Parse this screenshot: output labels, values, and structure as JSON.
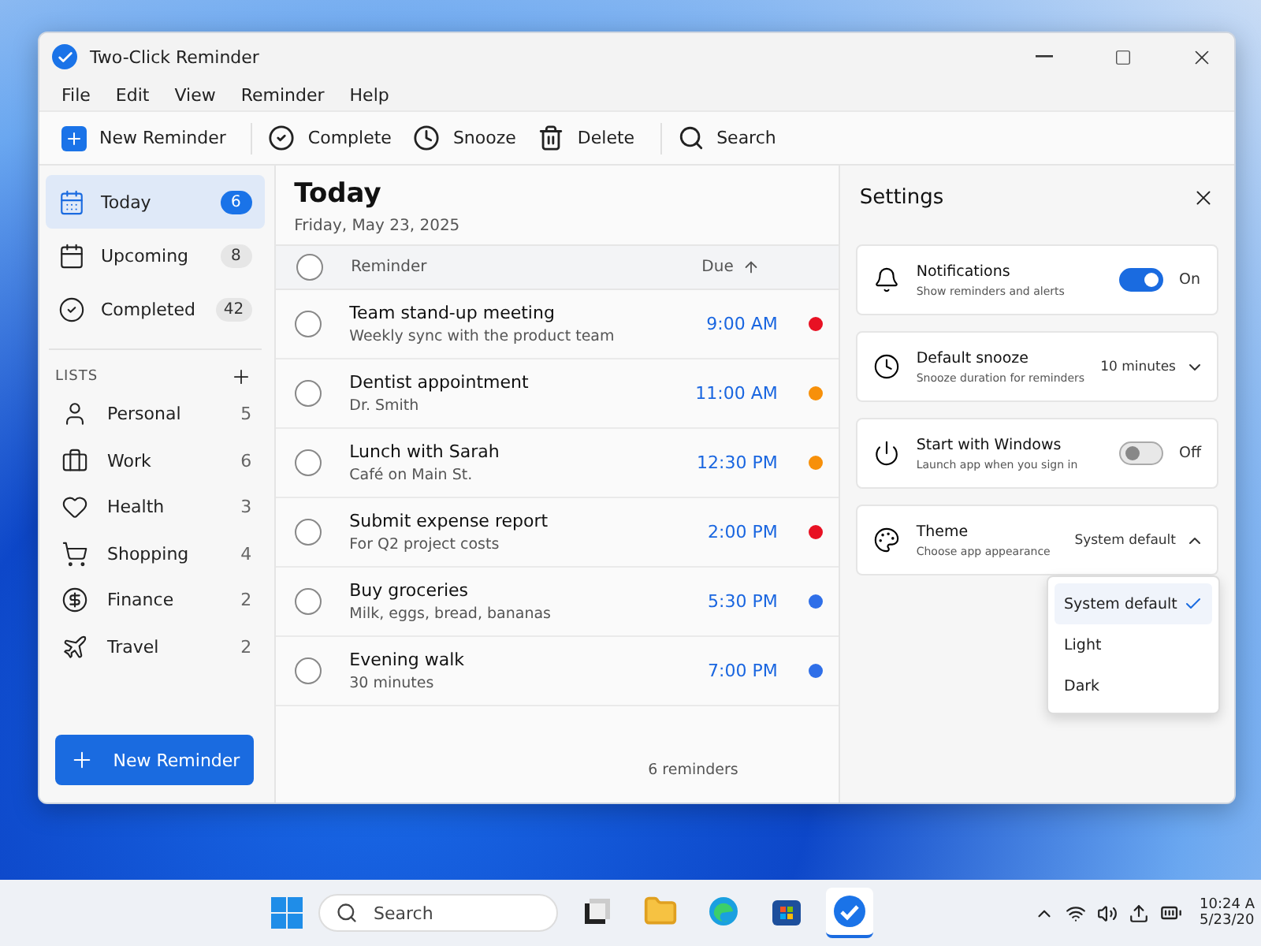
{
  "window": {
    "title": "Two-Click Reminder"
  },
  "menu": [
    "File",
    "Edit",
    "View",
    "Reminder",
    "Help"
  ],
  "toolbar": [
    {
      "kind": "new",
      "label": "New Reminder"
    },
    {
      "kind": "complete",
      "label": "Complete"
    },
    {
      "kind": "snooze",
      "label": "Snooze"
    },
    {
      "kind": "delete",
      "label": "Delete"
    },
    {
      "kind": "search",
      "label": "Search"
    }
  ],
  "sidebar": {
    "views": [
      {
        "kind": "today",
        "label": "Today",
        "count": "6",
        "selected": true
      },
      {
        "kind": "upcoming",
        "label": "Upcoming",
        "count": "8",
        "selected": false
      },
      {
        "kind": "completed",
        "label": "Completed",
        "count": "42",
        "selected": false
      }
    ],
    "lists_heading": "LISTS",
    "lists": [
      {
        "kind": "person",
        "label": "Personal",
        "count": "5"
      },
      {
        "kind": "work",
        "label": "Work",
        "count": "6"
      },
      {
        "kind": "health",
        "label": "Health",
        "count": "3"
      },
      {
        "kind": "shopping",
        "label": "Shopping",
        "count": "4"
      },
      {
        "kind": "finance",
        "label": "Finance",
        "count": "2"
      },
      {
        "kind": "travel",
        "label": "Travel",
        "count": "2"
      }
    ],
    "new_button": "New Reminder"
  },
  "main": {
    "title": "Today",
    "date": "Friday, May 23, 2025",
    "select_all_checked": false,
    "columns": {
      "reminder": "Reminder",
      "due": "Due"
    },
    "rows": [
      {
        "title": "Team stand-up meeting",
        "note": "Weekly sync with the product team",
        "due": "9:00 AM",
        "color": "#e81123",
        "checked": false
      },
      {
        "title": "Dentist appointment",
        "note": "Dr. Smith",
        "due": "11:00 AM",
        "color": "#f7900a",
        "checked": false
      },
      {
        "title": "Lunch with Sarah",
        "note": "Café on Main St.",
        "due": "12:30 PM",
        "color": "#f7900a",
        "checked": false
      },
      {
        "title": "Submit expense report",
        "note": "For Q2 project costs",
        "due": "2:00 PM",
        "color": "#e81123",
        "checked": false
      },
      {
        "title": "Buy groceries",
        "note": "Milk, eggs, bread, bananas",
        "due": "5:30 PM",
        "color": "#2f6fe8",
        "checked": false
      },
      {
        "title": "Evening walk",
        "note": "30 minutes",
        "due": "7:00 PM",
        "color": "#2f6fe8",
        "checked": false
      }
    ],
    "footer": "6 reminders"
  },
  "settings": {
    "title": "Settings",
    "items": [
      {
        "kind": "toggle",
        "title": "Notifications",
        "description": "Show reminders and alerts",
        "on": true,
        "value": "On"
      },
      {
        "kind": "select",
        "title": "Default snooze",
        "description": "Snooze duration for reminders",
        "value": "10 minutes",
        "expanded": false
      },
      {
        "kind": "toggle",
        "title": "Start with Windows",
        "description": "Launch app when you sign in",
        "on": false,
        "value": "Off"
      },
      {
        "kind": "select",
        "title": "Theme",
        "description": "Choose app appearance",
        "value": "System default",
        "expanded": true,
        "options": [
          {
            "label": "System default",
            "selected": true
          },
          {
            "label": "Light",
            "selected": false
          },
          {
            "label": "Dark",
            "selected": false
          }
        ]
      }
    ]
  },
  "taskbar": {
    "search_placeholder": "Search",
    "apps": [
      {
        "kind": "taskview",
        "selected": false
      },
      {
        "kind": "folder",
        "selected": false
      },
      {
        "kind": "browser",
        "selected": false
      },
      {
        "kind": "store",
        "selected": false
      },
      {
        "kind": "reminder",
        "selected": true
      }
    ],
    "time": "10:24 A",
    "date": "5/23/20"
  }
}
